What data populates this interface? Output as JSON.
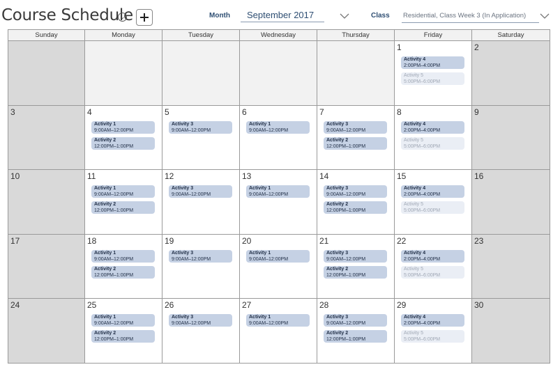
{
  "header": {
    "title": "Course Schedule",
    "month_label": "Month",
    "month_value": "September 2017",
    "class_label": "Class",
    "class_value": "Residential, Class Week 3 (In Application)"
  },
  "weekdays": [
    "Sunday",
    "Monday",
    "Tuesday",
    "Wednesday",
    "Thursday",
    "Friday",
    "Saturday"
  ],
  "weeks": [
    [
      {
        "day": "",
        "weekend": true,
        "empty": true,
        "activities": []
      },
      {
        "day": "",
        "empty": true,
        "activities": []
      },
      {
        "day": "",
        "empty": true,
        "activities": []
      },
      {
        "day": "",
        "empty": true,
        "activities": []
      },
      {
        "day": "",
        "empty": true,
        "activities": []
      },
      {
        "day": "1",
        "activities": [
          {
            "name": "Activity 4",
            "time": "2:00PM–4:00PM"
          },
          {
            "name": "Activity 5",
            "time": "5:00PM–6:00PM",
            "faded": true
          }
        ]
      },
      {
        "day": "2",
        "weekend": true,
        "activities": []
      }
    ],
    [
      {
        "day": "3",
        "weekend": true,
        "activities": []
      },
      {
        "day": "4",
        "activities": [
          {
            "name": "Activity 1",
            "time": "9:00AM–12:00PM"
          },
          {
            "name": "Activity 2",
            "time": "12:00PM–1:00PM"
          }
        ]
      },
      {
        "day": "5",
        "activities": [
          {
            "name": "Activity 3",
            "time": "9:00AM–12:00PM"
          }
        ]
      },
      {
        "day": "6",
        "activities": [
          {
            "name": "Activity 1",
            "time": "9:00AM–12:00PM"
          }
        ]
      },
      {
        "day": "7",
        "activities": [
          {
            "name": "Activity 3",
            "time": "9:00AM–12:00PM"
          },
          {
            "name": "Activity 2",
            "time": "12:00PM–1:00PM"
          }
        ]
      },
      {
        "day": "8",
        "activities": [
          {
            "name": "Activity 4",
            "time": "2:00PM–4:00PM"
          },
          {
            "name": "Activity 5",
            "time": "5:00PM–6:00PM",
            "faded": true
          }
        ]
      },
      {
        "day": "9",
        "weekend": true,
        "activities": []
      }
    ],
    [
      {
        "day": "10",
        "weekend": true,
        "activities": []
      },
      {
        "day": "11",
        "activities": [
          {
            "name": "Activity 1",
            "time": "9:00AM–12:00PM"
          },
          {
            "name": "Activity 2",
            "time": "12:00PM–1:00PM"
          }
        ]
      },
      {
        "day": "12",
        "activities": [
          {
            "name": "Activity 3",
            "time": "9:00AM–12:00PM"
          }
        ]
      },
      {
        "day": "13",
        "activities": [
          {
            "name": "Activity 1",
            "time": "9:00AM–12:00PM"
          }
        ]
      },
      {
        "day": "14",
        "activities": [
          {
            "name": "Activity 3",
            "time": "9:00AM–12:00PM"
          },
          {
            "name": "Activity 2",
            "time": "12:00PM–1:00PM"
          }
        ]
      },
      {
        "day": "15",
        "activities": [
          {
            "name": "Activity 4",
            "time": "2:00PM–4:00PM"
          },
          {
            "name": "Activity 5",
            "time": "5:00PM–6:00PM",
            "faded": true
          }
        ]
      },
      {
        "day": "16",
        "weekend": true,
        "activities": []
      }
    ],
    [
      {
        "day": "17",
        "weekend": true,
        "activities": []
      },
      {
        "day": "18",
        "activities": [
          {
            "name": "Activity 1",
            "time": "9:00AM–12:00PM"
          },
          {
            "name": "Activity 2",
            "time": "12:00PM–1:00PM"
          }
        ]
      },
      {
        "day": "19",
        "activities": [
          {
            "name": "Activity 3",
            "time": "9:00AM–12:00PM"
          }
        ]
      },
      {
        "day": "20",
        "activities": [
          {
            "name": "Activity 1",
            "time": "9:00AM–12:00PM"
          }
        ]
      },
      {
        "day": "21",
        "activities": [
          {
            "name": "Activity 3",
            "time": "9:00AM–12:00PM"
          },
          {
            "name": "Activity 2",
            "time": "12:00PM–1:00PM"
          }
        ]
      },
      {
        "day": "22",
        "activities": [
          {
            "name": "Activity 4",
            "time": "2:00PM–4:00PM"
          },
          {
            "name": "Activity 5",
            "time": "5:00PM–6:00PM",
            "faded": true
          }
        ]
      },
      {
        "day": "23",
        "weekend": true,
        "activities": []
      }
    ],
    [
      {
        "day": "24",
        "weekend": true,
        "activities": []
      },
      {
        "day": "25",
        "activities": [
          {
            "name": "Activity 1",
            "time": "9:00AM–12:00PM"
          },
          {
            "name": "Activity 2",
            "time": "12:00PM–1:00PM"
          }
        ]
      },
      {
        "day": "26",
        "activities": [
          {
            "name": "Activity 3",
            "time": "9:00AM–12:00PM"
          }
        ]
      },
      {
        "day": "27",
        "activities": [
          {
            "name": "Activity 1",
            "time": "9:00AM–12:00PM"
          }
        ]
      },
      {
        "day": "28",
        "activities": [
          {
            "name": "Activity 3",
            "time": "9:00AM–12:00PM"
          },
          {
            "name": "Activity 2",
            "time": "12:00PM–1:00PM"
          }
        ]
      },
      {
        "day": "29",
        "activities": [
          {
            "name": "Activity 4",
            "time": "2:00PM–4:00PM"
          },
          {
            "name": "Activity 5",
            "time": "5:00PM–6:00PM",
            "faded": true
          }
        ]
      },
      {
        "day": "30",
        "weekend": true,
        "activities": []
      }
    ]
  ],
  "colors": {
    "activity": "#c5d1e4",
    "activity_faded": "#eaeef5",
    "weekend": "#d9d9d9",
    "accent": "#2e4e72"
  }
}
